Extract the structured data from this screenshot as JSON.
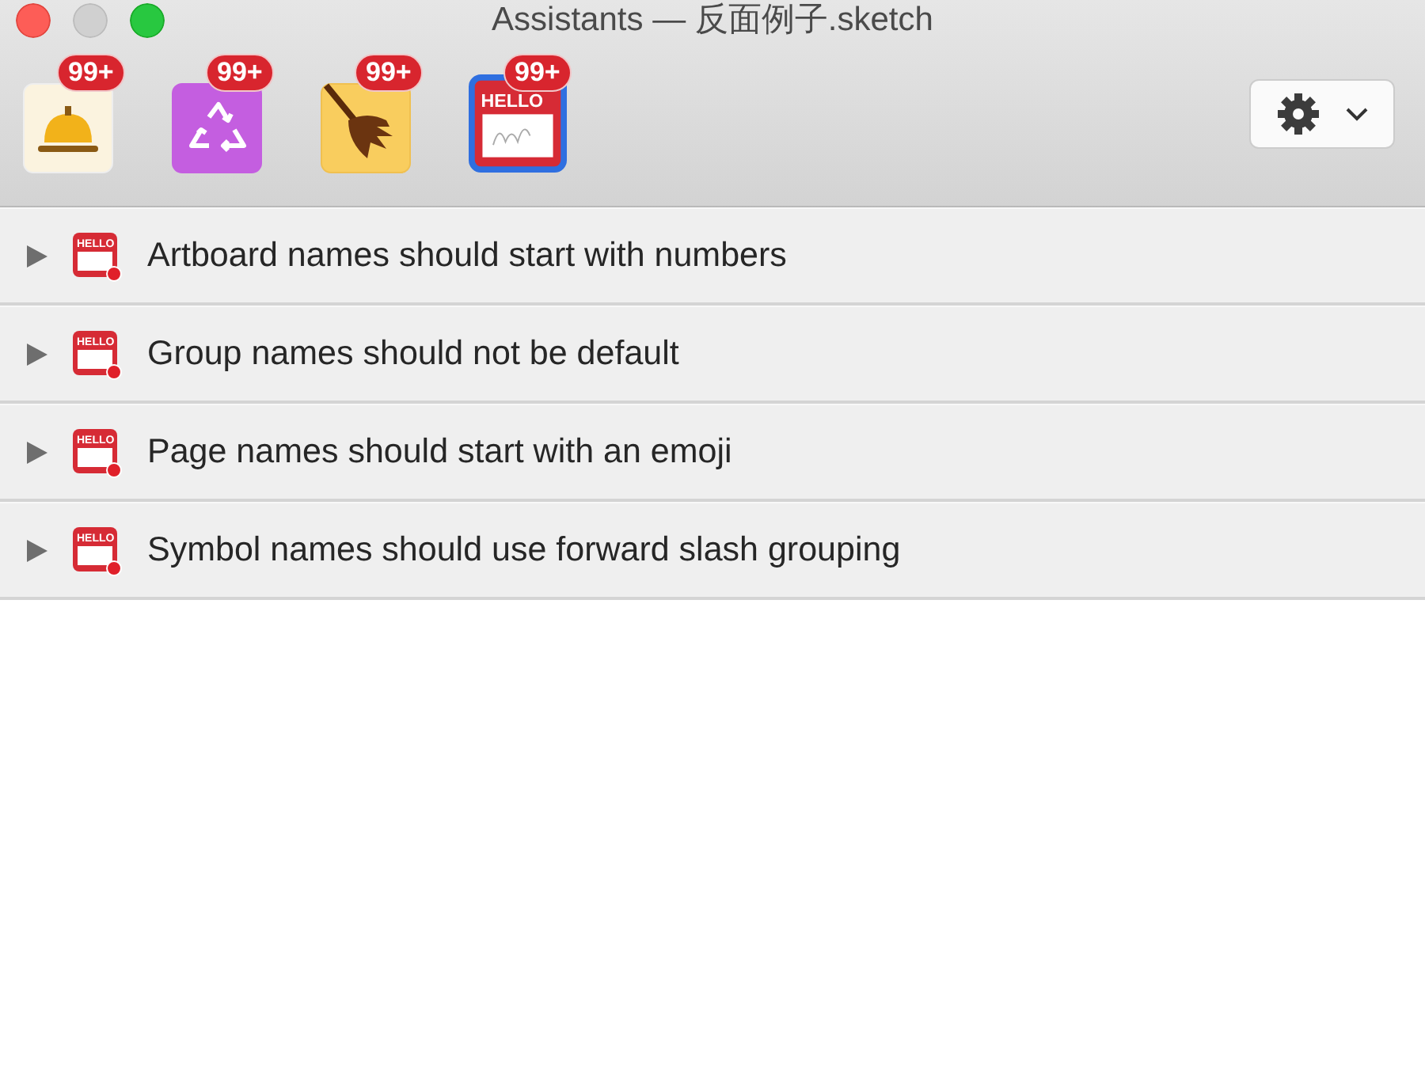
{
  "window": {
    "title": "Assistants — 反面例子.sketch"
  },
  "toolbar": {
    "assistants": [
      {
        "kind": "bell",
        "badge": "99+",
        "selected": false
      },
      {
        "kind": "recycle",
        "badge": "99+",
        "selected": false
      },
      {
        "kind": "broom",
        "badge": "99+",
        "selected": false
      },
      {
        "kind": "hello",
        "badge": "99+",
        "selected": true,
        "icon_text": "HELLO"
      }
    ]
  },
  "rules": [
    {
      "label": "Artboard names should start with numbers",
      "icon_text": "HELLO",
      "expanded": false
    },
    {
      "label": "Group names should not be default",
      "icon_text": "HELLO",
      "expanded": false
    },
    {
      "label": "Page names should start with an emoji",
      "icon_text": "HELLO",
      "expanded": false
    },
    {
      "label": "Symbol names should use forward slash grouping",
      "icon_text": "HELLO",
      "expanded": false
    }
  ]
}
